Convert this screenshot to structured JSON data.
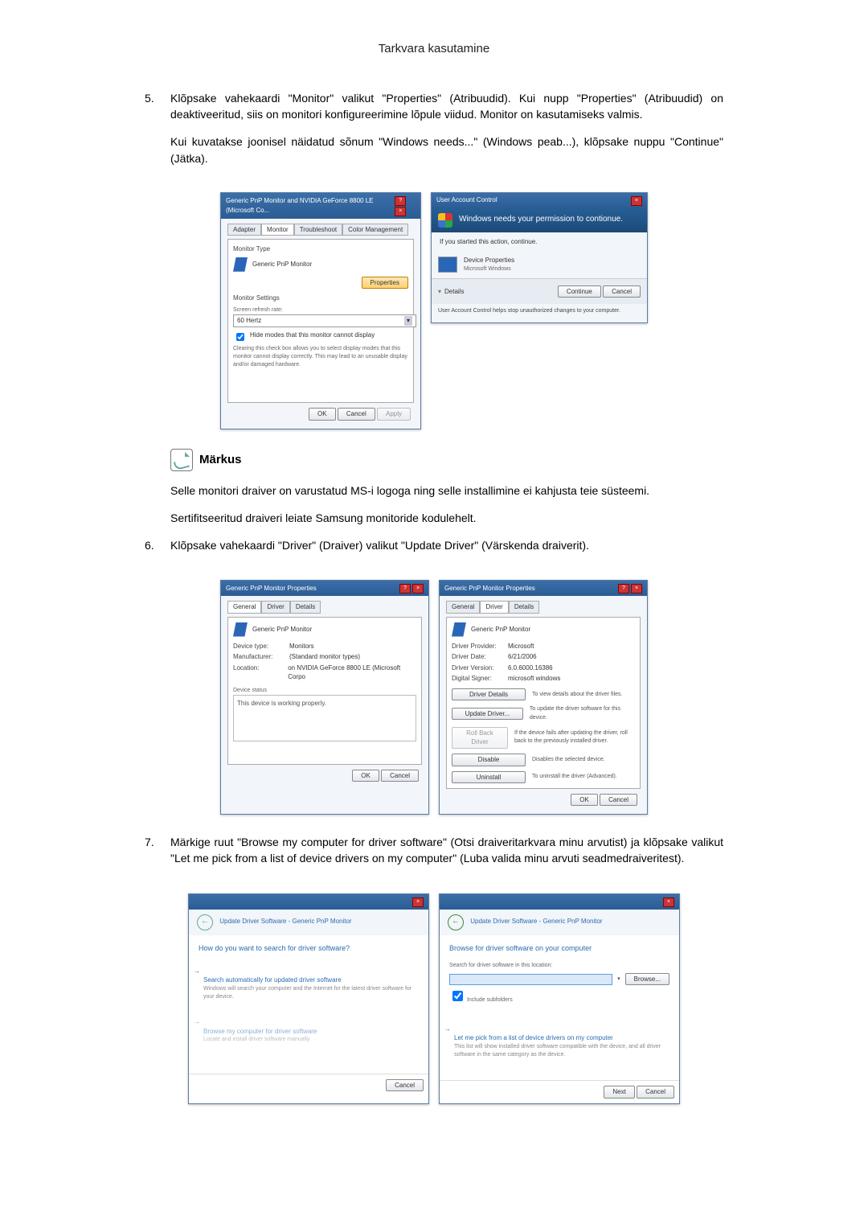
{
  "header": "Tarkvara kasutamine",
  "steps": {
    "s5": {
      "num": "5.",
      "p1": "Klõpsake vahekaardi \"Monitor\" valikut \"Properties\" (Atribuudid). Kui nupp \"Properties\" (Atribuudid) on deaktiveeritud, siis on monitori konfigureerimine lõpule viidud. Monitor on kasutamiseks valmis.",
      "p2": "Kui kuvatakse joonisel näidatud sõnum \"Windows needs...\" (Windows peab...), klõpsake nuppu \"Continue\" (Jätka)."
    },
    "s6": {
      "num": "6.",
      "p1": "Klõpsake vahekaardi \"Driver\" (Draiver) valikut \"Update Driver\" (Värskenda draiverit)."
    },
    "s7": {
      "num": "7.",
      "p1": "Märkige ruut \"Browse my computer for driver software\" (Otsi draiveritarkvara minu arvutist) ja klõpsake valikut \"Let me pick from a list of device drivers on my computer\" (Luba valida minu arvuti seadmedraiveritest)."
    }
  },
  "note": {
    "title": "Märkus",
    "p1": "Selle monitori draiver on varustatud MS-i logoga ning selle installimine ei kahjusta teie süsteemi.",
    "p2": "Sertifitseeritud draiveri leiate Samsung monitoride kodulehelt."
  },
  "fig1": {
    "left": {
      "title": "Generic PnP Monitor and NVIDIA GeForce 8800 LE (Microsoft Co...",
      "tabs": {
        "adapter": "Adapter",
        "monitor": "Monitor",
        "troubleshoot": "Troubleshoot",
        "colormgmt": "Color Management"
      },
      "monitor_type": "Monitor Type",
      "monitor_name": "Generic PnP Monitor",
      "properties_btn": "Properties",
      "monitor_settings": "Monitor Settings",
      "refresh_label": "Screen refresh rate:",
      "refresh_value": "60 Hertz",
      "hide_modes_label": "Hide modes that this monitor cannot display",
      "hide_modes_desc": "Clearing this check box allows you to select display modes that this monitor cannot display correctly. This may lead to an unusable display and/or damaged hardware.",
      "ok": "OK",
      "cancel": "Cancel",
      "apply": "Apply"
    },
    "right": {
      "title": "User Account Control",
      "banner": "Windows needs your permission to contionue.",
      "started": "If you started this action, continue.",
      "prog_name": "Device Properties",
      "publisher": "Microsoft Windows",
      "details": "Details",
      "continue": "Continue",
      "cancel": "Cancel",
      "footer": "User Account Control helps stop unauthorized changes to your computer."
    }
  },
  "fig2": {
    "left": {
      "title": "Generic PnP Monitor Properties",
      "tabs": {
        "general": "General",
        "driver": "Driver",
        "details": "Details"
      },
      "name": "Generic PnP Monitor",
      "rows": {
        "type_k": "Device type:",
        "type_v": "Monitors",
        "mfr_k": "Manufacturer:",
        "mfr_v": "(Standard monitor types)",
        "loc_k": "Location:",
        "loc_v": "on NVIDIA GeForce 8800 LE (Microsoft Corpo"
      },
      "status_label": "Device status",
      "status_text": "This device is working properly.",
      "ok": "OK",
      "cancel": "Cancel"
    },
    "right": {
      "title": "Generic PnP Monitor Properties",
      "tabs": {
        "general": "General",
        "driver": "Driver",
        "details": "Details"
      },
      "name": "Generic PnP Monitor",
      "rows": {
        "prov_k": "Driver Provider:",
        "prov_v": "Microsoft",
        "date_k": "Driver Date:",
        "date_v": "6/21/2006",
        "ver_k": "Driver Version:",
        "ver_v": "6.0.6000.16386",
        "sign_k": "Digital Signer:",
        "sign_v": "microsoft windows"
      },
      "btns": {
        "details": "Driver Details",
        "details_d": "To view details about the driver files.",
        "update": "Update Driver...",
        "update_d": "To update the driver software for this device.",
        "rollback": "Roll Back Driver",
        "rollback_d": "If the device fails after updating the driver, roll back to the previously installed driver.",
        "disable": "Disable",
        "disable_d": "Disables the selected device.",
        "uninstall": "Uninstall",
        "uninstall_d": "To uninstall the driver (Advanced)."
      },
      "ok": "OK",
      "cancel": "Cancel"
    }
  },
  "fig3": {
    "left": {
      "crumb": "Update Driver Software - Generic PnP Monitor",
      "q": "How do you want to search for driver software?",
      "opt1_h": "Search automatically for updated driver software",
      "opt1_s": "Windows will search your computer and the Internet for the latest driver software for your device.",
      "opt2_h": "Browse my computer for driver software",
      "opt2_s": "Locate and install driver software manually.",
      "cancel": "Cancel"
    },
    "right": {
      "crumb": "Update Driver Software - Generic PnP Monitor",
      "q": "Browse for driver software on your computer",
      "search_label": "Search for driver software in this location:",
      "browse": "Browse...",
      "include": "Include subfolders",
      "opt_h": "Let me pick from a list of device drivers on my computer",
      "opt_s": "This list will show installed driver software compatible with the device, and all driver software in the same category as the device.",
      "next": "Next",
      "cancel": "Cancel"
    }
  }
}
